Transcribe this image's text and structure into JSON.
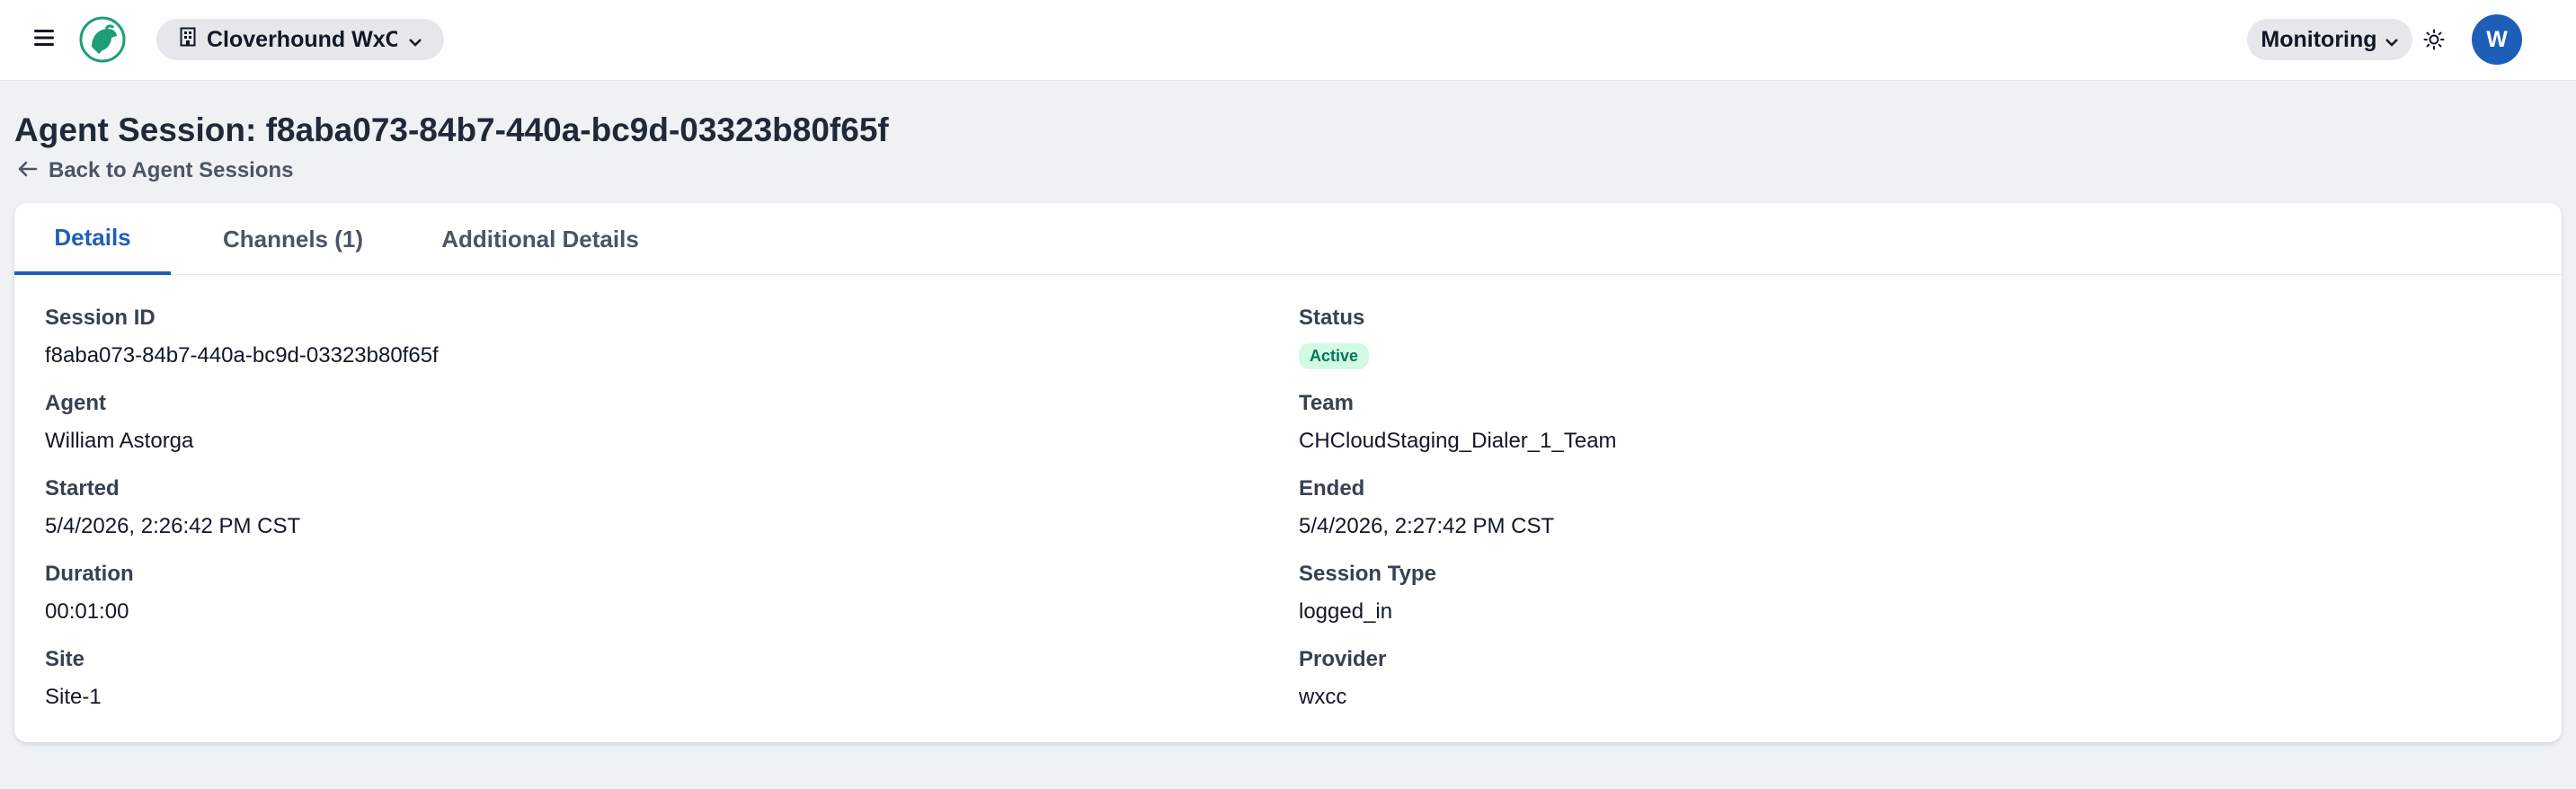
{
  "topbar": {
    "org_label": "Cloverhound WxC...",
    "nav_label": "Monitoring",
    "avatar_initial": "W"
  },
  "header": {
    "title": "Agent Session: f8aba073-84b7-440a-bc9d-03323b80f65f",
    "back_label": "Back to Agent Sessions"
  },
  "tabs": [
    {
      "label": "Details",
      "active": true
    },
    {
      "label": "Channels (1)",
      "active": false
    },
    {
      "label": "Additional Details",
      "active": false
    }
  ],
  "details": {
    "session_id": {
      "label": "Session ID",
      "value": "f8aba073-84b7-440a-bc9d-03323b80f65f"
    },
    "status": {
      "label": "Status",
      "value": "Active"
    },
    "agent": {
      "label": "Agent",
      "value": "William Astorga"
    },
    "team": {
      "label": "Team",
      "value": "CHCloudStaging_Dialer_1_Team"
    },
    "started": {
      "label": "Started",
      "value": "5/4/2026, 2:26:42 PM CST"
    },
    "ended": {
      "label": "Ended",
      "value": "5/4/2026, 2:27:42 PM CST"
    },
    "duration": {
      "label": "Duration",
      "value": "00:01:00"
    },
    "session_type": {
      "label": "Session Type",
      "value": "logged_in"
    },
    "site": {
      "label": "Site",
      "value": "Site-1"
    },
    "provider": {
      "label": "Provider",
      "value": "wxcc"
    }
  },
  "colors": {
    "accent": "#1d5fb8",
    "logo": "#1e9e76",
    "status_bg": "#d1fae5",
    "status_text": "#047857"
  },
  "icons": [
    "hamburger-menu-icon",
    "hound-logo-icon",
    "building-icon",
    "chevron-down-icon",
    "sun-icon",
    "arrow-left-icon"
  ]
}
